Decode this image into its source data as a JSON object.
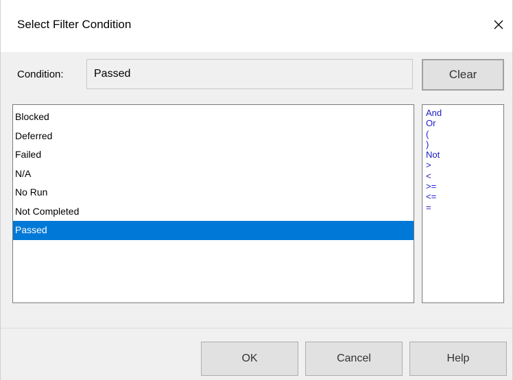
{
  "dialog": {
    "title": "Select Filter Condition",
    "close_icon": "close-icon"
  },
  "condition": {
    "label": "Condition:",
    "value": "Passed",
    "clear_label": "Clear"
  },
  "values": {
    "items": [
      "Blocked",
      "Deferred",
      "Failed",
      "N/A",
      "No Run",
      "Not Completed",
      "Passed"
    ],
    "selected": "Passed"
  },
  "operators": {
    "items": [
      "And",
      "Or",
      "(",
      ")",
      "Not",
      ">",
      "<",
      ">=",
      "<=",
      "="
    ]
  },
  "footer": {
    "ok_label": "OK",
    "cancel_label": "Cancel",
    "help_label": "Help"
  },
  "colors": {
    "selection": "#0078d7",
    "operator_text": "#1a1ac8",
    "dialog_bg": "#f0f0f0"
  }
}
